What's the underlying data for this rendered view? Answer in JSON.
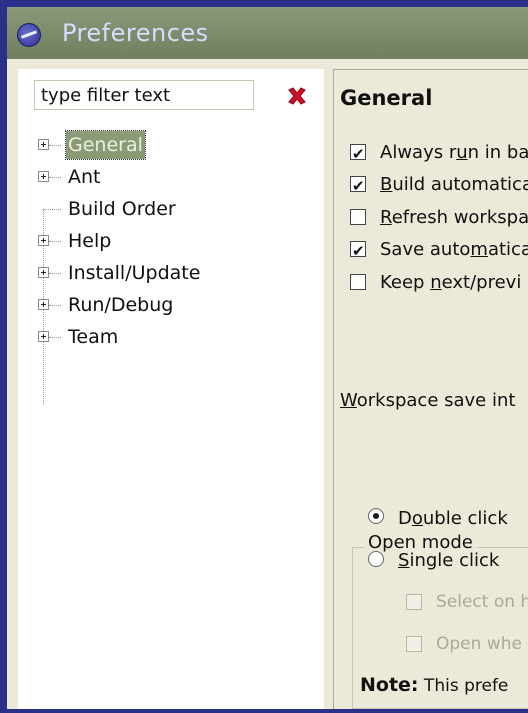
{
  "window": {
    "title": "Preferences"
  },
  "filter": {
    "value": "type filter text"
  },
  "tree": {
    "items": [
      {
        "label": "General",
        "expandable": true,
        "selected": true
      },
      {
        "label": "Ant",
        "expandable": true
      },
      {
        "label": "Build Order",
        "expandable": false
      },
      {
        "label": "Help",
        "expandable": true
      },
      {
        "label": "Install/Update",
        "expandable": true
      },
      {
        "label": "Run/Debug",
        "expandable": true
      },
      {
        "label": "Team",
        "expandable": true
      }
    ]
  },
  "page": {
    "heading": "General",
    "checkboxes": [
      {
        "pre": "Always r",
        "u": "u",
        "post": "n in ba",
        "checked": true
      },
      {
        "pre": "",
        "u": "B",
        "post": "uild automatica",
        "checked": true
      },
      {
        "pre": "",
        "u": "R",
        "post": "efresh workspa",
        "checked": false
      },
      {
        "pre": "Save auto",
        "u": "m",
        "post": "atica",
        "checked": true
      },
      {
        "pre": "Keep ",
        "u": "n",
        "post": "ext/previ",
        "checked": false
      }
    ],
    "workspace_save": {
      "u": "W",
      "post": "orkspace save int"
    },
    "open_mode": {
      "title": "Open mode",
      "double": {
        "pre": "D",
        "u": "o",
        "post": "uble click",
        "selected": true
      },
      "single": {
        "pre": "",
        "u": "S",
        "post": "ingle click",
        "selected": false
      },
      "sub1": "Select on h",
      "sub2": "Open whe"
    },
    "note": {
      "bold": "Note:",
      "text": " This prefe"
    }
  },
  "colors": {
    "titlebar": "#7b8b6a",
    "selection": "#8b9b78",
    "frame": "#2a2f8a",
    "dialog": "#ece9d8"
  }
}
